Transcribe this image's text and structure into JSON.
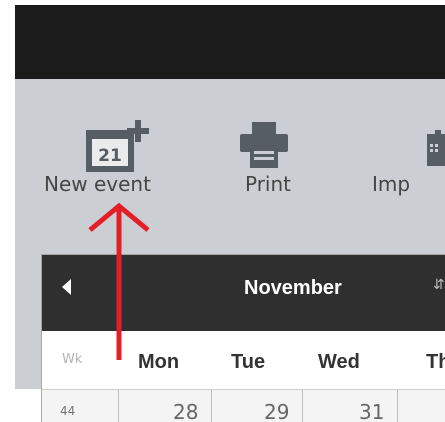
{
  "toolbar": {
    "buttons": [
      {
        "label": "New event",
        "icon": "calendar-add-icon",
        "icon_day": "21"
      },
      {
        "label": "Print",
        "icon": "printer-icon"
      },
      {
        "label": "Imp",
        "icon": "import-icon"
      }
    ]
  },
  "calendar": {
    "month": "November",
    "weekday_header": "Wk",
    "days": [
      "Mon",
      "Tue",
      "Wed",
      "Th"
    ],
    "first_row": {
      "week": "44",
      "dates": [
        "28",
        "29",
        "31"
      ]
    }
  },
  "annotation": {
    "color": "#e41e26"
  }
}
